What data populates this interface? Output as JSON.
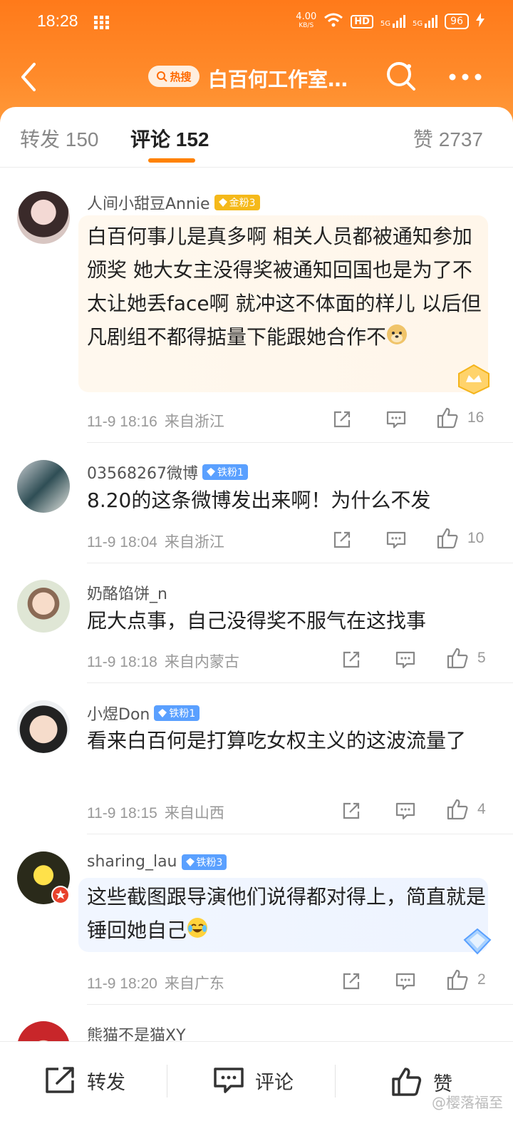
{
  "status": {
    "time": "18:28",
    "net_speed_top": "4.00",
    "net_speed_bottom": "KB/S",
    "hd": "HD",
    "sig1": "5G",
    "sig2": "5G",
    "battery": "96"
  },
  "nav": {
    "hot_label": "热搜",
    "title": "白百何工作室…"
  },
  "tabs": {
    "repost": "转发 150",
    "comment": "评论 152",
    "like": "赞 2737"
  },
  "comments": [
    {
      "user": "人间小甜豆Annie",
      "badge": "金粉3",
      "badge_type": "gold",
      "text": "白百何事儿是真多啊 相关人员都被通知参加颁奖 她大女主没得奖被通知回国也是为了不太让她丢face啊 就冲这不体面的样儿 以后但凡剧组不都得掂量下能跟她合作不",
      "emoji": "doge",
      "time": "11-9 18:16",
      "location": "来自浙江",
      "likes": "16"
    },
    {
      "user": "03568267微博",
      "badge": "铁粉1",
      "badge_type": "iron",
      "text": "8.20的这条微博发出来啊！为什么不发",
      "time": "11-9 18:04",
      "location": "来自浙江",
      "likes": "10"
    },
    {
      "user": "奶酪馅饼_n",
      "badge": "",
      "text": "屁大点事，自己没得奖不服气在这找事",
      "time": "11-9 18:18",
      "location": "来自内蒙古",
      "likes": "5"
    },
    {
      "user": "小煜Don",
      "badge": "铁粉1",
      "badge_type": "iron",
      "text": "看来白百何是打算吃女权主义的这波流量了",
      "time": "11-9 18:15",
      "location": "来自山西",
      "likes": "4"
    },
    {
      "user": "sharing_lau",
      "badge": "铁粉3",
      "badge_type": "iron",
      "text": "这些截图跟导演他们说得都对得上，简直就是锤回她自己",
      "emoji": "laugh-cry",
      "time": "11-9 18:20",
      "location": "来自广东",
      "likes": "2"
    },
    {
      "user": "熊猫不是猫XY"
    }
  ],
  "bottom": {
    "repost": "转发",
    "comment": "评论",
    "like": "赞"
  },
  "watermark": "@樱落福至",
  "colors": {
    "accent": "#ff8200",
    "topbar": "#ff7a1a",
    "gold_badge": "#f5b91a",
    "iron_badge": "#5aa0ff"
  }
}
